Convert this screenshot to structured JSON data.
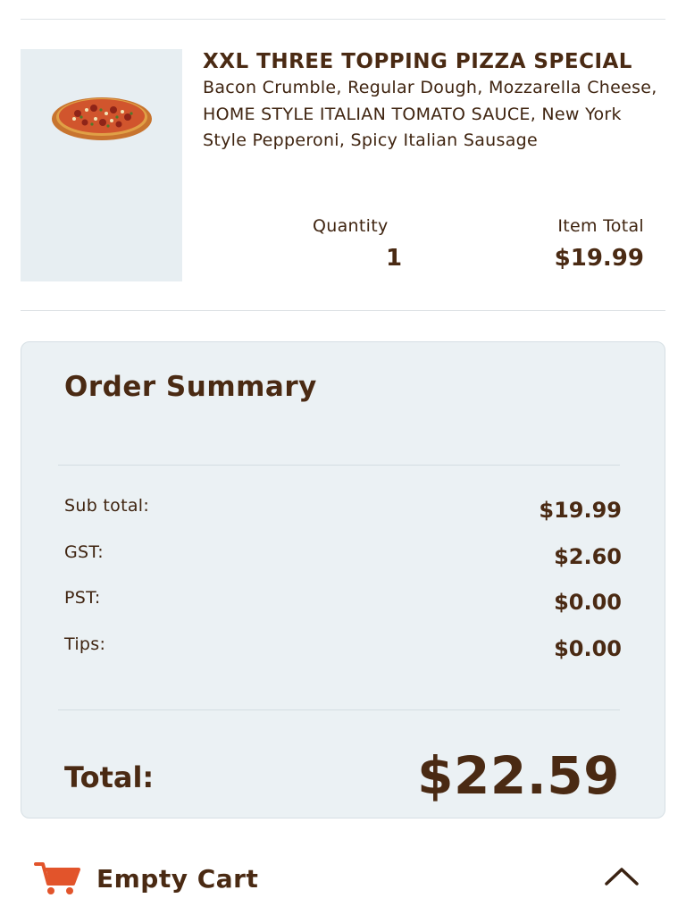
{
  "item": {
    "title": "XXL THREE TOPPING PIZZA SPECIAL",
    "description": "Bacon Crumble, Regular Dough, Mozzarella Cheese, HOME STYLE ITALIAN TOMATO SAUCE, New York Style Pepperoni, Spicy Italian Sausage",
    "image_icon": "pizza-image",
    "quantity_label": "Quantity",
    "quantity": "1",
    "item_total_label": "Item Total",
    "item_total": "$19.99"
  },
  "summary": {
    "title": "Order Summary",
    "rows": [
      {
        "label": "Sub total:",
        "value": "$19.99"
      },
      {
        "label": "GST:",
        "value": "$2.60"
      },
      {
        "label": "PST:",
        "value": "$0.00"
      },
      {
        "label": "Tips:",
        "value": "$0.00"
      }
    ],
    "total_label": "Total:",
    "total_value": "$22.59"
  },
  "footer": {
    "empty_cart_label": "Empty Cart",
    "cart_icon": "cart-icon",
    "toggle_icon": "chevron-up-icon"
  },
  "colors": {
    "text_brown": "#4a2a13",
    "accent_orange": "#e2542b",
    "card_bg": "#ebf1f4",
    "image_bg": "#e7eef2"
  }
}
